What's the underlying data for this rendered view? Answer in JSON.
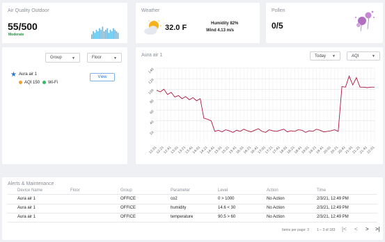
{
  "air_quality": {
    "title": "Air Quality Outdoor",
    "value": "55/500",
    "status": "Moderate",
    "mini_bars": [
      3,
      5,
      4,
      6,
      5,
      7,
      6,
      8,
      5,
      6,
      7,
      4,
      6,
      5,
      7,
      6,
      5,
      4
    ]
  },
  "weather": {
    "title": "Weather",
    "temperature": "32.0 F",
    "humidity": "Humidity 82%",
    "wind": "Wind 4.13 m/s",
    "icon": "sun-cloud-icon"
  },
  "pollen": {
    "title": "Pollen",
    "value": "0/5",
    "icon": "pollen-flower-icon"
  },
  "devices_panel": {
    "group_select": "Group",
    "floor_select": "Floor",
    "device_name": "Aura air 1",
    "aqi_label": "AQI 150",
    "wifi_label": "Wi-Fi",
    "view_button": "View",
    "colors": {
      "star": "#2b74d4",
      "aqi_dot": "#f2a22c",
      "wifi_dot": "#2ebd59"
    }
  },
  "chart_panel": {
    "title": "Aura air 1",
    "range_select": "Today",
    "metric_select": "AQI"
  },
  "chart_data": {
    "type": "line",
    "title": "",
    "xlabel": "",
    "ylabel": "",
    "ylim": [
      0,
      140
    ],
    "yticks": [
      20,
      40,
      60,
      80,
      100,
      120,
      140
    ],
    "color": "#b0143c",
    "x": [
      "12:01",
      "12:11",
      "12:21",
      "12:31",
      "12:41",
      "12:51",
      "13:01",
      "13:11",
      "13:21",
      "13:31",
      "13:41",
      "13:51",
      "14:01",
      "14:11",
      "14:21",
      "14:31",
      "14:41",
      "14:51",
      "15:01",
      "15:11",
      "15:21",
      "15:31",
      "15:41",
      "15:51",
      "16:01",
      "16:11",
      "16:21",
      "16:31",
      "16:41",
      "16:51",
      "17:01",
      "17:11",
      "17:21",
      "17:31",
      "17:41",
      "17:51",
      "18:01",
      "18:11",
      "18:21",
      "18:31",
      "18:41",
      "18:51",
      "19:01",
      "19:11",
      "19:21",
      "19:31",
      "19:41",
      "19:51",
      "20:01",
      "20:11",
      "20:21",
      "20:31",
      "20:41",
      "20:51",
      "21:01",
      "21:11",
      "21:21",
      "21:31",
      "21:41",
      "21:51",
      "22:01"
    ],
    "values": [
      98,
      95,
      100,
      90,
      94,
      85,
      88,
      82,
      86,
      80,
      84,
      78,
      82,
      45,
      43,
      40,
      20,
      22,
      19,
      23,
      21,
      18,
      22,
      20,
      24,
      21,
      19,
      22,
      25,
      20,
      18,
      23,
      21,
      20,
      22,
      24,
      19,
      21,
      20,
      23,
      22,
      18,
      21,
      20,
      24,
      22,
      19,
      20,
      21,
      23,
      20,
      105,
      104,
      125,
      108,
      122,
      104,
      104,
      103,
      104,
      104
    ],
    "xtick_labels": [
      "12:01",
      "12:21",
      "12:41",
      "13:01",
      "13:21",
      "13:41",
      "14:01",
      "14:21",
      "14:41",
      "15:01",
      "15:21",
      "15:41",
      "16:01",
      "16:21",
      "16:41",
      "17:01",
      "17:21",
      "17:41",
      "18:01",
      "18:21",
      "18:41",
      "19:01",
      "19:21",
      "19:41",
      "20:01",
      "20:21",
      "20:41",
      "21:01",
      "21:21",
      "21:41",
      "22:01"
    ],
    "grid": true
  },
  "alerts": {
    "title": "Alerts & Maintenance",
    "columns": [
      "Device Name",
      "Floor",
      "Group",
      "Parameter",
      "Level",
      "Action",
      "Time"
    ],
    "rows": [
      [
        "Aura air 1",
        "",
        "OFFICE",
        "co2",
        "0 > 1000",
        "No Action",
        "2/3/21, 12:49 PM"
      ],
      [
        "Aura air 1",
        "",
        "OFFICE",
        "humidity",
        "14.6 < 30",
        "No Action",
        "2/3/21, 12:49 PM"
      ],
      [
        "Aura air 1",
        "",
        "OFFICE",
        "temperature",
        "90.5 > 60",
        "No Action",
        "2/3/21, 12:49 PM"
      ]
    ],
    "items_per_page_label": "Items per page: 3",
    "range_label": "1 – 3 of 183",
    "first_icon": "|<",
    "prev_icon": "<",
    "next_icon": ">",
    "last_icon": ">|"
  }
}
